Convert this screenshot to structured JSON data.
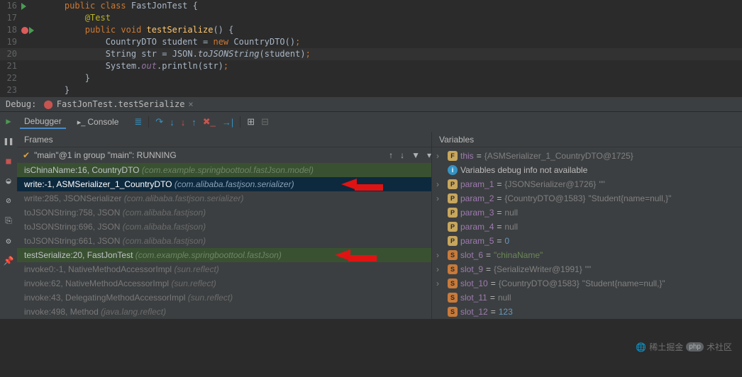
{
  "code": {
    "lines": [
      {
        "num": "16",
        "run": true,
        "bp": false,
        "indent": 1,
        "tokens": "kw:public| |kw:class| |type-id:FastJonTest| |brace:{"
      },
      {
        "num": "17",
        "run": false,
        "bp": false,
        "indent": 2,
        "tokens": "anno:@Test"
      },
      {
        "num": "18",
        "run": true,
        "bp": true,
        "indent": 2,
        "tokens": "kw:public| |kw:void| |method-decl:testSerialize|paren:()| |brace:{"
      },
      {
        "num": "19",
        "run": false,
        "bp": false,
        "indent": 3,
        "tokens": "type-id:CountryDTO| |type-id:student| |neutral:=| |kw:new| |type-id:CountryDTO()|semi:;"
      },
      {
        "num": "20",
        "run": false,
        "bp": false,
        "hl": true,
        "indent": 3,
        "tokens": "type-id:String| |type-id:str| |neutral:=| |type-id:JSON|neutral:.|static-call:toJSONString|neutral:(student)|semi:;"
      },
      {
        "num": "21",
        "run": false,
        "bp": false,
        "indent": 3,
        "tokens": "type-id:System|neutral:.|out-field:out|neutral:.println(str)|semi:;"
      },
      {
        "num": "22",
        "run": false,
        "bp": false,
        "indent": 2,
        "tokens": "brace:}"
      },
      {
        "num": "23",
        "run": false,
        "bp": false,
        "indent": 1,
        "tokens": "brace:}"
      }
    ]
  },
  "debug_bar": {
    "label": "Debug:",
    "tab": "FastJonTest.testSerialize"
  },
  "debugger_tabs": {
    "debugger": "Debugger",
    "console": "Console"
  },
  "frames": {
    "header": "Frames",
    "thread": "\"main\"@1 in group \"main\": RUNNING",
    "items": [
      {
        "cls": "highlight",
        "main": "isChinaName:16, CountryDTO ",
        "pkg": "(com.example.springboottool.fastJson.model)"
      },
      {
        "cls": "selected",
        "main": "write:-1, ASMSerializer_1_CountryDTO ",
        "pkg": "(com.alibaba.fastjson.serializer)",
        "arrow": true,
        "arrowLeft": 457
      },
      {
        "cls": "dim",
        "main": "write:285, JSONSerializer ",
        "pkg": "(com.alibaba.fastjson.serializer)"
      },
      {
        "cls": "dim",
        "main": "toJSONString:758, JSON ",
        "pkg": "(com.alibaba.fastjson)"
      },
      {
        "cls": "dim",
        "main": "toJSONString:696, JSON ",
        "pkg": "(com.alibaba.fastjson)"
      },
      {
        "cls": "dim",
        "main": "toJSONString:661, JSON ",
        "pkg": "(com.alibaba.fastjson)"
      },
      {
        "cls": "highlight",
        "main": "testSerialize:20, FastJonTest ",
        "pkg": "(com.example.springboottool.fastJson)",
        "arrow": true,
        "arrowLeft": 448
      },
      {
        "cls": "dim",
        "main": "invoke0:-1, NativeMethodAccessorImpl ",
        "pkg": "(sun.reflect)"
      },
      {
        "cls": "dim",
        "main": "invoke:62, NativeMethodAccessorImpl ",
        "pkg": "(sun.reflect)"
      },
      {
        "cls": "dim",
        "main": "invoke:43, DelegatingMethodAccessorImpl ",
        "pkg": "(sun.reflect)"
      },
      {
        "cls": "dim",
        "main": "invoke:498, Method ",
        "pkg": "(java.lang.reflect)"
      }
    ]
  },
  "variables": {
    "header": "Variables",
    "items": [
      {
        "icon": "f",
        "exp": "›",
        "name": "this",
        "val_obj": "{ASMSerializer_1_CountryDTO@1725}"
      },
      {
        "icon": "info",
        "special": "Variables debug info not available"
      },
      {
        "icon": "p",
        "exp": "›",
        "name": "param_1",
        "val_obj": "{JSONSerializer@1726}",
        "after_str": " \"\""
      },
      {
        "icon": "p",
        "exp": "›",
        "name": "param_2",
        "val_obj": "{CountryDTO@1583}",
        "after_str": " \"Student{name=null,}\""
      },
      {
        "icon": "p",
        "name": "param_3",
        "val_raw": "null"
      },
      {
        "icon": "p",
        "name": "param_4",
        "val_raw": "null"
      },
      {
        "icon": "p",
        "name": "param_5",
        "val_num": "0"
      },
      {
        "icon": "s",
        "exp": "›",
        "name": "slot_6",
        "val_str": "\"chinaName\""
      },
      {
        "icon": "s",
        "exp": "›",
        "name": "slot_9",
        "val_obj": "{SerializeWriter@1991}",
        "after_str": " \"\""
      },
      {
        "icon": "s",
        "exp": "›",
        "name": "slot_10",
        "val_obj": "{CountryDTO@1583}",
        "after_str": " \"Student{name=null,}\""
      },
      {
        "icon": "s",
        "name": "slot_11",
        "val_raw": "null"
      },
      {
        "icon": "s",
        "name": "slot_12",
        "val_num": "123"
      }
    ]
  },
  "watermark": {
    "text": "稀土掘金技术社区",
    "logo": "php"
  }
}
